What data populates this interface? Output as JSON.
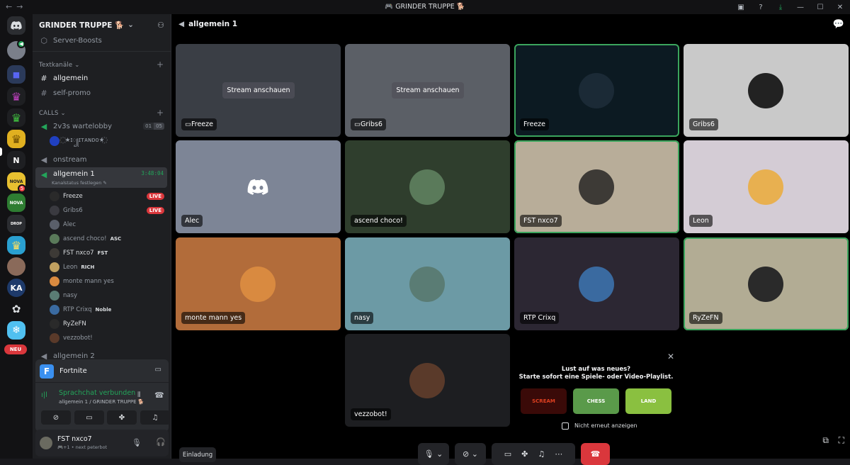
{
  "app": {
    "title": "GRINDER TRUPPE 🐕"
  },
  "rail": {
    "new_label": "NEU",
    "badges": [
      "5"
    ],
    "letters": {
      "n": "N",
      "ka": "KA"
    }
  },
  "server": {
    "name": "GRINDER TRUPPE 🐕",
    "boosts": "Server-Boosts"
  },
  "categories": {
    "text": "Textkanäle",
    "calls": "CALLS"
  },
  "text_channels": [
    "allgemein",
    "self-promo"
  ],
  "voice_channels": {
    "wartelobby": {
      "name": "2v3s wartelobby",
      "count_a": "01",
      "count_b": "05",
      "user": "꙰ ★ɪ꧀ɪᴛᴀɴᴅᴏ★꙰"
    },
    "onstream": "onstream",
    "allgemein1": {
      "name": "allgemein 1",
      "timer": "3:48:04",
      "status": "Kanalstatus festlegen"
    },
    "allgemein2": "allgemein 2"
  },
  "voice_users": [
    {
      "name": "Freeze",
      "live": "LIVE",
      "color": "#dbdee1"
    },
    {
      "name": "Gribs6",
      "live": "LIVE",
      "color": "#949ba4"
    },
    {
      "name": "Alec",
      "color": "#949ba4"
    },
    {
      "name": "ascend choco!",
      "tag": "ASC",
      "color": "#949ba4"
    },
    {
      "name": "FST nxco7",
      "tag": "FST",
      "color": "#dbdee1"
    },
    {
      "name": "Leon",
      "tag": "RICH",
      "color": "#949ba4"
    },
    {
      "name": "monte mann yes",
      "color": "#949ba4"
    },
    {
      "name": "nasy",
      "color": "#949ba4"
    },
    {
      "name": "RTP Crixq",
      "tag": "Noble",
      "color": "#949ba4"
    },
    {
      "name": "RyZeFN",
      "color": "#dbdee1"
    },
    {
      "name": "vezzobot!",
      "color": "#949ba4"
    }
  ],
  "activity": {
    "game": "Fortnite",
    "voice_status": "Sprachchat verbunden",
    "voice_location": "allgemein 1 / GRINDER TRUPPE 🐕"
  },
  "user": {
    "name": "FST nxco7",
    "status": "🎮+1 • next peterbot"
  },
  "main": {
    "channel": "allgemein 1",
    "stream_button": "Stream anschauen",
    "invite": "Einladung"
  },
  "tiles": [
    {
      "name": "Freeze",
      "bg": "#3a3e45",
      "stream": true
    },
    {
      "name": "Gribs6",
      "bg": "#5b5f66",
      "stream": true
    },
    {
      "name": "Freeze",
      "bg": "#0c1a22",
      "avatar": "#1b2a36"
    },
    {
      "name": "Gribs6",
      "bg": "#c9c9c9",
      "avatar": "#222"
    },
    {
      "name": "Alec",
      "bg": "#7d8596",
      "avatar": "discord"
    },
    {
      "name": "ascend choco!",
      "bg": "#2f3e2d",
      "avatar": "#5a7a5a"
    },
    {
      "name": "FST nxco7",
      "bg": "#b8ad99",
      "avatar": "#3d3a36"
    },
    {
      "name": "Leon",
      "bg": "#d4ccd5",
      "avatar": "#e8b050"
    },
    {
      "name": "monte mann yes",
      "bg": "#b26c3a",
      "avatar": "#d98a40"
    },
    {
      "name": "nasy",
      "bg": "#6c9aa5",
      "avatar": "#5a7c74"
    },
    {
      "name": "RTP Crixq",
      "bg": "#2c2733",
      "avatar": "#3a6aa0"
    },
    {
      "name": "RyZeFN",
      "bg": "#b2ac94",
      "avatar": "#2a2a2a"
    },
    {
      "name": "vezzobot!",
      "bg": "#1d1e21",
      "avatar": "#5a3a2a"
    }
  ],
  "promo": {
    "title": "Lust auf was neues?",
    "subtitle": "Starte sofort eine Spiele- oder Video-Playlist.",
    "checkbox": "Nicht erneut anzeigen",
    "games": [
      "SCREAM",
      "CHESS",
      "LAND"
    ]
  }
}
